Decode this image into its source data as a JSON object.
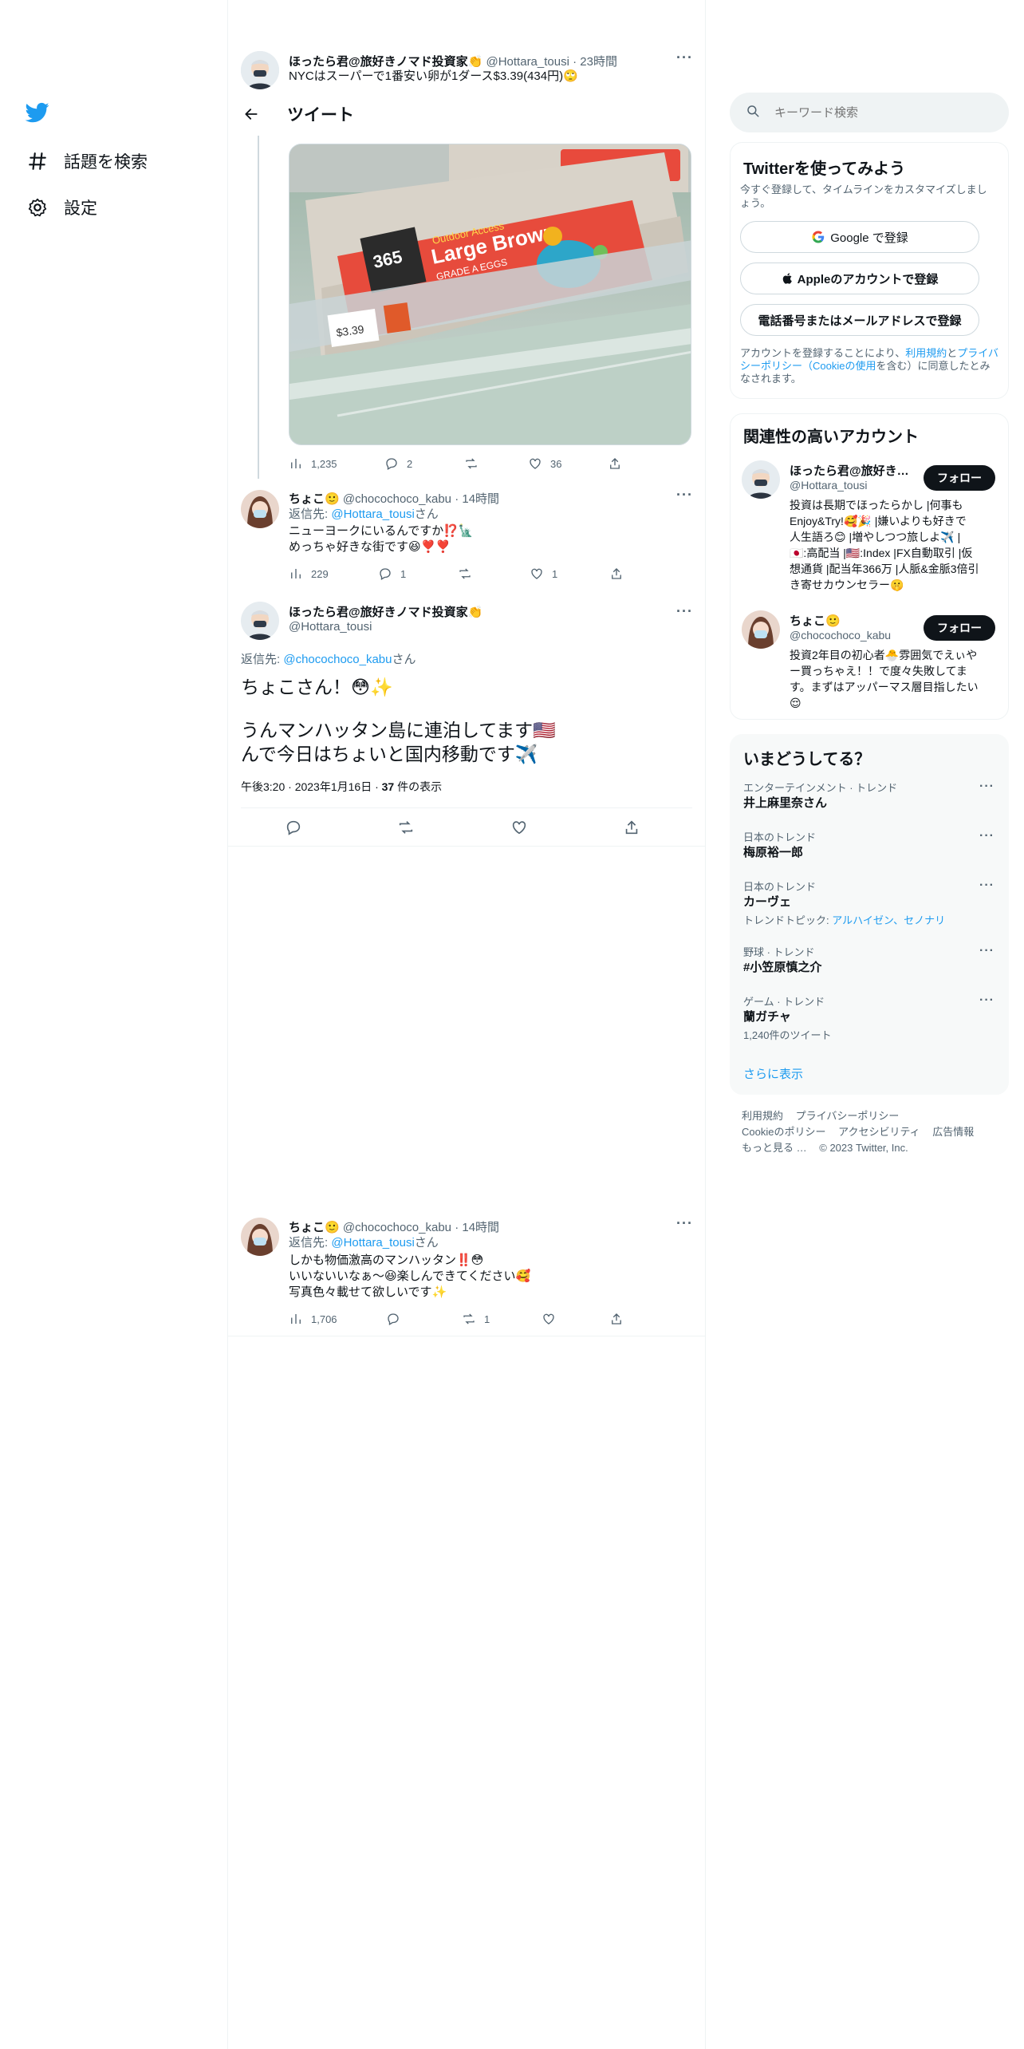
{
  "left_nav": {
    "explore_label": "話題を検索",
    "settings_label": "設定"
  },
  "header": {
    "title": "ツイート"
  },
  "tweets": [
    {
      "display_name": "ほったら君@旅好きノマド投資家👏",
      "handle": "@Hottara_tousi",
      "time": "23時間",
      "text": "NYCはスーパーで1番安い卵が1ダース$3.39(434円)🙄",
      "views": "1,235",
      "replies": "2",
      "retweets": "",
      "likes": "36"
    },
    {
      "display_name": "ちょこ🙂",
      "handle": "@chocochoco_kabu",
      "time": "14時間",
      "reply_to_label": "返信先: ",
      "reply_to_handle": "@Hottara_tousi",
      "reply_to_suffix": "さん",
      "text_lines": [
        "ニューヨークにいるんですか⁉️🗽",
        "めっちゃ好きな街です😆❣️❣️"
      ],
      "views": "229",
      "replies": "1",
      "retweets": "",
      "likes": "1"
    }
  ],
  "main_tweet": {
    "display_name": "ほったら君@旅好きノマド投資家👏",
    "handle": "@Hottara_tousi",
    "reply_to_label": "返信先: ",
    "reply_to_handle": "@chocochoco_kabu",
    "reply_to_suffix": "さん",
    "text_lines": [
      "ちょこさん！😳✨",
      "",
      "うんマンハッタン島に連泊してます🇺🇸",
      "んで今日はちょいと国内移動です✈️"
    ],
    "timestamp": "午後3:20 · 2023年1月16日 · ",
    "views_count": "37",
    "views_suffix": " 件の表示"
  },
  "reply_tweet": {
    "display_name": "ちょこ🙂",
    "handle": "@chocochoco_kabu",
    "time": "14時間",
    "reply_to_label": "返信先: ",
    "reply_to_handle": "@Hottara_tousi",
    "reply_to_suffix": "さん",
    "text_lines": [
      "しかも物価激高のマンハッタン‼️😳",
      "いいないいなぁ〜😆楽しんできてください🥰",
      "写真色々載せて欲しいです✨"
    ],
    "views": "1,706",
    "replies": "",
    "retweets": "1",
    "likes": ""
  },
  "image": {
    "price_label": "$3.39",
    "box_brand": "365",
    "box_title_1": "Outdoor Access",
    "box_title_2": "Large Brown",
    "box_title_3": "GRADE A EGGS"
  },
  "search": {
    "placeholder": "キーワード検索"
  },
  "signup": {
    "title": "Twitterを使ってみよう",
    "subtitle": "今すぐ登録して、タイムラインをカスタマイズしましょう。",
    "google": "Google で登録",
    "apple": "Appleのアカウントで登録",
    "phone": "電話番号またはメールアドレスで登録",
    "terms_1": "アカウントを登録することにより、",
    "terms_link1": "利用規約",
    "terms_2": "と",
    "terms_link2": "プライバシーポリシー（Cookieの使用",
    "terms_3": "を含む）に同意したとみなされます。"
  },
  "related": {
    "title": "関連性の高いアカウント",
    "accounts": [
      {
        "name": "ほったら君@旅好き…",
        "handle": "@Hottara_tousi",
        "follow": "フォロー",
        "bio_lines": [
          "投資は長期でほったらかし |何事も",
          "Enjoy&Try!🥰🎉 |嫌いよりも好きで",
          "人生語ろ😊 |増やしつつ旅しよ✈️ |",
          "🇯🇵:高配当 |🇺🇸:Index |FX自動取引 |仮",
          "想通貨 |配当年366万 |人脈&金脈3倍引",
          "き寄せカウンセラー🤫"
        ]
      },
      {
        "name": "ちょこ🙂",
        "handle": "@chocochoco_kabu",
        "follow": "フォロー",
        "bio_lines": [
          "投資2年目の初心者🐣雰囲気でえぃや",
          "ー買っちゃえ！！で度々失敗してま",
          "す。まずはアッパーマス層目指したい",
          "😌"
        ]
      }
    ]
  },
  "trends": {
    "title": "いまどうしてる？",
    "items": [
      {
        "category": "エンターテインメント · トレンド",
        "name": "井上麻里奈さん",
        "extra": ""
      },
      {
        "category": "日本のトレンド",
        "name": "梅原裕一郎",
        "extra": ""
      },
      {
        "category": "日本のトレンド",
        "name": "カーヴェ",
        "extra_label": "トレンドトピック: ",
        "extra_links": "アルハイゼン、セノナリ"
      },
      {
        "category": "野球 · トレンド",
        "name": "#小笠原慎之介",
        "extra": ""
      },
      {
        "category": "ゲーム · トレンド",
        "name": "蘭ガチャ",
        "extra": "1,240件のツイート"
      }
    ],
    "show_more": "さらに表示"
  },
  "footer": {
    "row1": [
      "利用規約",
      "プライバシーポリシー"
    ],
    "row2": [
      "Cookieのポリシー",
      "アクセシビリティ",
      "広告情報"
    ],
    "more": "もっと見る …",
    "copyright": "© 2023 Twitter, Inc."
  },
  "colors": {
    "accent": "#1d9bf0",
    "text": "#0f1419",
    "muted": "#536471",
    "border": "#eff3f4"
  }
}
